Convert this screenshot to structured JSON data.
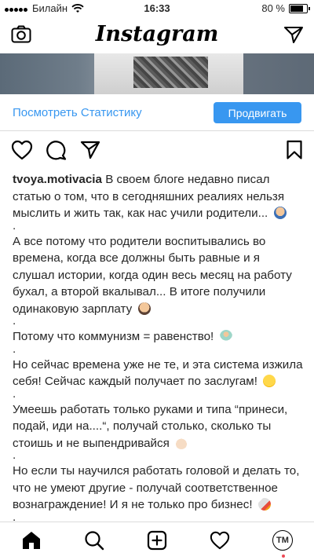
{
  "status_bar": {
    "carrier": "Билайн",
    "time": "16:33",
    "battery": "80 %"
  },
  "header": {
    "logo": "Instagram"
  },
  "post": {
    "statistics_link": "Посмотреть Статистику",
    "promote_button": "Продвигать",
    "username": "tvoya.motivacia",
    "caption_lines": [
      {
        "text": "В своем блоге недавно писал статью о том, что в сегодняшних реалиях нельзя мыслить и жить так, как нас учили родители...",
        "emoji": "man-shrugging"
      },
      {
        "text": ".",
        "emoji": ""
      },
      {
        "text": "А все потому что родители воспитывались во времена, когда все должны быть равные и я слушал истории, когда один весь месяц на работу бухал, а второй вкалывал... В итоге получили одинаковую зарплату",
        "emoji": "man-facepalming"
      },
      {
        "text": ".",
        "emoji": ""
      },
      {
        "text": "Потому что коммунизм = равенство!",
        "emoji": "fairy"
      },
      {
        "text": ".",
        "emoji": ""
      },
      {
        "text": "Но сейчас времена уже не те, и эта система изжила себя! Сейчас каждый получает по заслугам!",
        "emoji": "slightly-smiling-face"
      },
      {
        "text": ".",
        "emoji": ""
      },
      {
        "text": "Умеешь работать только руками и типа “принеси, подай, иди на....“, получай столько, сколько ты стоишь и не выпендривайся",
        "emoji": "index-pointing-up"
      },
      {
        "text": ".",
        "emoji": ""
      },
      {
        "text": "Но если ты научился работать головой и делать то, что не умеют другие - получай соответственное вознаграждение! И я не только про бизнес!",
        "emoji": "rocket"
      },
      {
        "text": ".",
        "emoji": ""
      }
    ]
  },
  "tab_bar": {
    "profile_initials": "ТМ"
  },
  "colors": {
    "accent": "#3897f0",
    "text": "#262626",
    "divider": "#dbdbdb",
    "notification_dot": "#ed4956"
  }
}
